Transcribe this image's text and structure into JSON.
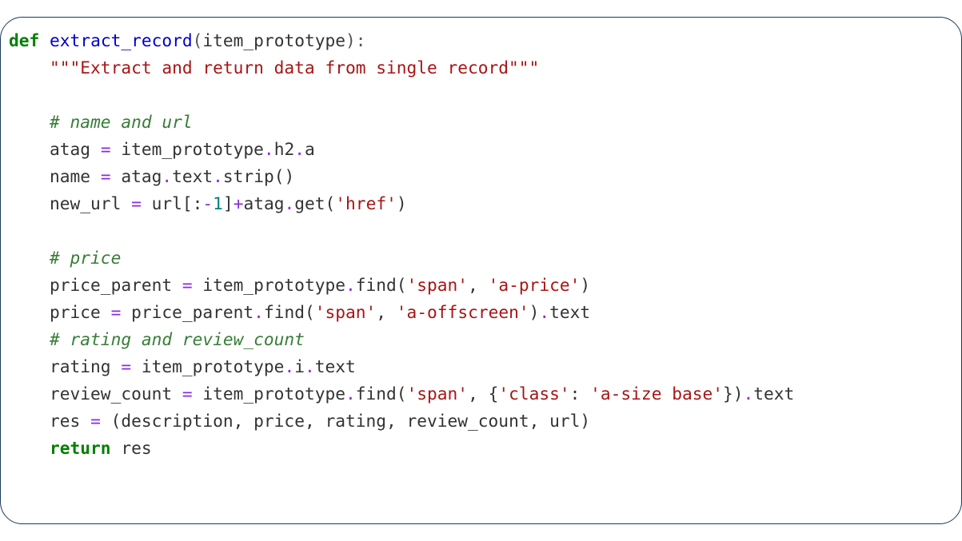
{
  "code": {
    "lang": "python",
    "lines": [
      {
        "indent": 0,
        "tokens": [
          {
            "cls": "tok-kw",
            "text": "def"
          },
          {
            "cls": "",
            "text": " "
          },
          {
            "cls": "tok-fn",
            "text": "extract_record"
          },
          {
            "cls": "tok-punct",
            "text": "("
          },
          {
            "cls": "tok-param",
            "text": "item_prototype"
          },
          {
            "cls": "tok-punct",
            "text": "):"
          }
        ]
      },
      {
        "indent": 1,
        "tokens": [
          {
            "cls": "tok-doc",
            "text": "\"\"\"Extract and return data from single record\"\"\""
          }
        ]
      },
      {
        "indent": 0,
        "tokens": []
      },
      {
        "indent": 1,
        "tokens": [
          {
            "cls": "tok-comment",
            "text": "# name and url"
          }
        ]
      },
      {
        "indent": 1,
        "tokens": [
          {
            "cls": "",
            "text": "atag "
          },
          {
            "cls": "tok-op",
            "text": "="
          },
          {
            "cls": "",
            "text": " item_prototype"
          },
          {
            "cls": "tok-op",
            "text": "."
          },
          {
            "cls": "",
            "text": "h2"
          },
          {
            "cls": "tok-op",
            "text": "."
          },
          {
            "cls": "",
            "text": "a"
          }
        ]
      },
      {
        "indent": 1,
        "tokens": [
          {
            "cls": "",
            "text": "name "
          },
          {
            "cls": "tok-op",
            "text": "="
          },
          {
            "cls": "",
            "text": " atag"
          },
          {
            "cls": "tok-op",
            "text": "."
          },
          {
            "cls": "",
            "text": "text"
          },
          {
            "cls": "tok-op",
            "text": "."
          },
          {
            "cls": "",
            "text": "strip()"
          }
        ]
      },
      {
        "indent": 1,
        "tokens": [
          {
            "cls": "",
            "text": "new_url "
          },
          {
            "cls": "tok-op",
            "text": "="
          },
          {
            "cls": "",
            "text": " url[:"
          },
          {
            "cls": "tok-op",
            "text": "-"
          },
          {
            "cls": "tok-num",
            "text": "1"
          },
          {
            "cls": "",
            "text": "]"
          },
          {
            "cls": "tok-op",
            "text": "+"
          },
          {
            "cls": "",
            "text": "atag"
          },
          {
            "cls": "tok-op",
            "text": "."
          },
          {
            "cls": "",
            "text": "get("
          },
          {
            "cls": "tok-str",
            "text": "'href'"
          },
          {
            "cls": "",
            "text": ")"
          }
        ]
      },
      {
        "indent": 0,
        "tokens": []
      },
      {
        "indent": 1,
        "tokens": [
          {
            "cls": "tok-comment",
            "text": "# price"
          }
        ]
      },
      {
        "indent": 1,
        "tokens": [
          {
            "cls": "",
            "text": "price_parent "
          },
          {
            "cls": "tok-op",
            "text": "="
          },
          {
            "cls": "",
            "text": " item_prototype"
          },
          {
            "cls": "tok-op",
            "text": "."
          },
          {
            "cls": "",
            "text": "find("
          },
          {
            "cls": "tok-str",
            "text": "'span'"
          },
          {
            "cls": "",
            "text": ", "
          },
          {
            "cls": "tok-str",
            "text": "'a-price'"
          },
          {
            "cls": "",
            "text": ")"
          }
        ]
      },
      {
        "indent": 1,
        "tokens": [
          {
            "cls": "",
            "text": "price "
          },
          {
            "cls": "tok-op",
            "text": "="
          },
          {
            "cls": "",
            "text": " price_parent"
          },
          {
            "cls": "tok-op",
            "text": "."
          },
          {
            "cls": "",
            "text": "find("
          },
          {
            "cls": "tok-str",
            "text": "'span'"
          },
          {
            "cls": "",
            "text": ", "
          },
          {
            "cls": "tok-str",
            "text": "'a-offscreen'"
          },
          {
            "cls": "",
            "text": ")"
          },
          {
            "cls": "tok-op",
            "text": "."
          },
          {
            "cls": "",
            "text": "text"
          }
        ]
      },
      {
        "indent": 1,
        "tokens": [
          {
            "cls": "tok-comment",
            "text": "# rating and review_count"
          }
        ]
      },
      {
        "indent": 1,
        "tokens": [
          {
            "cls": "",
            "text": "rating "
          },
          {
            "cls": "tok-op",
            "text": "="
          },
          {
            "cls": "",
            "text": " item_prototype"
          },
          {
            "cls": "tok-op",
            "text": "."
          },
          {
            "cls": "",
            "text": "i"
          },
          {
            "cls": "tok-op",
            "text": "."
          },
          {
            "cls": "",
            "text": "text"
          }
        ]
      },
      {
        "indent": 1,
        "tokens": [
          {
            "cls": "",
            "text": "review_count "
          },
          {
            "cls": "tok-op",
            "text": "="
          },
          {
            "cls": "",
            "text": " item_prototype"
          },
          {
            "cls": "tok-op",
            "text": "."
          },
          {
            "cls": "",
            "text": "find("
          },
          {
            "cls": "tok-str",
            "text": "'span'"
          },
          {
            "cls": "",
            "text": ", {"
          },
          {
            "cls": "tok-str",
            "text": "'class'"
          },
          {
            "cls": "",
            "text": ": "
          },
          {
            "cls": "tok-str",
            "text": "'a-size base'"
          },
          {
            "cls": "",
            "text": "})"
          },
          {
            "cls": "tok-op",
            "text": "."
          },
          {
            "cls": "",
            "text": "text"
          }
        ]
      },
      {
        "indent": 1,
        "tokens": [
          {
            "cls": "",
            "text": "res "
          },
          {
            "cls": "tok-op",
            "text": "="
          },
          {
            "cls": "",
            "text": " (description, price, rating, review_count, url)"
          }
        ]
      },
      {
        "indent": 1,
        "tokens": [
          {
            "cls": "tok-kw",
            "text": "return"
          },
          {
            "cls": "",
            "text": " res"
          }
        ]
      }
    ]
  }
}
